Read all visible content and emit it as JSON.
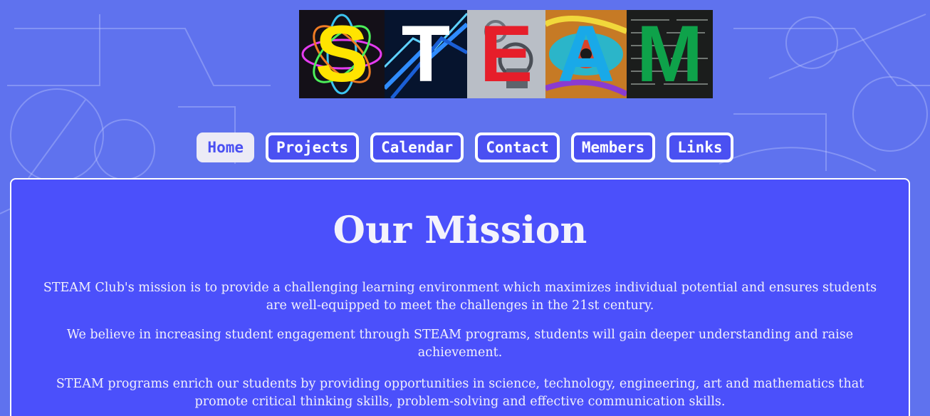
{
  "banner": {
    "letters": [
      "S",
      "T",
      "E",
      "A",
      "M"
    ],
    "letter_colors": [
      "#ffe400",
      "#ffffff",
      "#e61e2a",
      "#19a9e8",
      "#0ea24a"
    ]
  },
  "nav": {
    "items": [
      {
        "label": "Home",
        "active": true
      },
      {
        "label": "Projects",
        "active": false
      },
      {
        "label": "Calendar",
        "active": false
      },
      {
        "label": "Contact",
        "active": false
      },
      {
        "label": "Members",
        "active": false
      },
      {
        "label": "Links",
        "active": false
      }
    ]
  },
  "main": {
    "title": "Our Mission",
    "paragraphs": [
      "STEAM Club's mission is to provide a challenging learning environment which maximizes individual potential and ensures students are well-equipped to meet the challenges in the 21st century.",
      "We believe in increasing student engagement through STEAM programs, students will gain deeper understanding and raise achievement.",
      "STEAM programs enrich our students by providing opportunities in science, technology, engineering, art and mathematics that promote critical thinking skills, problem-solving and effective communication skills."
    ]
  },
  "colors": {
    "background": "#5f72ee",
    "panel": "#4b50fb",
    "nav_button": "#4a50f2",
    "nav_active": "#ecebf6"
  }
}
